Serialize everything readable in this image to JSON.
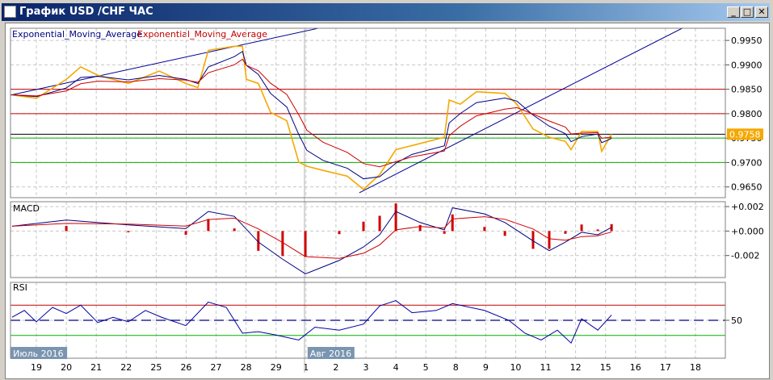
{
  "window": {
    "title": "График USD /CHF  ЧАС",
    "minimize": "_",
    "maximize": "□",
    "close": "✕"
  },
  "legend": {
    "ema1": "Exponential_Moving_Average",
    "ema2": "Exponential_Moving_Average"
  },
  "colors": {
    "price": "#f5a800",
    "ema1": "#000080",
    "ema2": "#d00000",
    "resistance": "#c00000",
    "support": "#00b000",
    "trend": "#000090",
    "macd": "#000080",
    "signal": "#d00000",
    "hist": "#d00000",
    "rsi": "#0000a0"
  },
  "x_axis": {
    "labels": [
      "19",
      "20",
      "21",
      "22",
      "25",
      "26",
      "27",
      "28",
      "29",
      "1",
      "2",
      "3",
      "4",
      "5",
      "8",
      "9",
      "10",
      "11",
      "12",
      "15",
      "16",
      "17",
      "18"
    ],
    "months": [
      {
        "label": "Июль 2016",
        "index": -0.86
      },
      {
        "label": "Авг 2016",
        "index": 9.0
      }
    ]
  },
  "chart_data": [
    {
      "type": "line",
      "title": "USD/CHF H1",
      "yticks": [
        "0.9950",
        "0.9900",
        "0.9850",
        "0.9800",
        "0.9750",
        "0.9700",
        "0.9650"
      ],
      "ylim": [
        0.9628,
        0.9975
      ],
      "current_price": "0.9758",
      "hlines": {
        "resistance": [
          0.985,
          0.98
        ],
        "support": [
          0.975,
          0.97
        ],
        "current": 0.9758
      },
      "trendlines": [
        [
          [
            -0.86,
            0.9838
          ],
          [
            9.44,
            0.99754
          ]
        ],
        [
          [
            10.78,
            0.96381
          ],
          [
            21.57,
            0.99754
          ]
        ]
      ],
      "price": {
        "x": [
          -0.81,
          0,
          1.0,
          1.48,
          2.05,
          3.07,
          4.1,
          4.99,
          5.39,
          5.74,
          6.61,
          6.88,
          7.01,
          7.41,
          7.82,
          8.36,
          8.76,
          9.03,
          9.57,
          10.38,
          10.92,
          11.46,
          12.0,
          12.54,
          13.62,
          13.78,
          14.15,
          14.69,
          15.64,
          16.04,
          16.58,
          17.12,
          17.66,
          17.85,
          18.2,
          18.74,
          18.87,
          19.2
        ],
        "y": [
          0.98386,
          0.98314,
          0.98703,
          0.98958,
          0.98788,
          0.98619,
          0.98873,
          0.98619,
          0.98534,
          0.99297,
          0.99381,
          0.99381,
          0.98703,
          0.98619,
          0.98025,
          0.97856,
          0.97008,
          0.96924,
          0.96839,
          0.9672,
          0.96449,
          0.96754,
          0.97263,
          0.97347,
          0.97517,
          0.9828,
          0.98195,
          0.98449,
          0.98415,
          0.98195,
          0.97686,
          0.97517,
          0.97432,
          0.97263,
          0.97636,
          0.97636,
          0.97229,
          0.9758
        ]
      }
    },
    {
      "type": "line",
      "title": "MACD",
      "yticks": [
        "+0.002",
        "+0.000",
        "-0.002"
      ],
      "ylim": [
        -0.0038,
        0.0024
      ],
      "x": [
        -0.81,
        1.0,
        3.07,
        4.99,
        5.74,
        6.61,
        7.41,
        8.22,
        8.98,
        10.11,
        10.92,
        11.46,
        12.0,
        12.81,
        13.62,
        13.89,
        14.96,
        15.64,
        16.58,
        17.12,
        17.66,
        18.2,
        18.74,
        19.2
      ],
      "macd": [
        0.0004,
        0.0009,
        0.0005,
        0.0002,
        0.0016,
        0.0012,
        -0.0009,
        -0.0023,
        -0.0035,
        -0.0024,
        -0.0013,
        -0.0003,
        0.0016,
        0.0007,
        0.0001,
        0.0019,
        0.0014,
        0.0007,
        -0.0008,
        -0.0016,
        -0.0009,
        -0.0001,
        -0.0003,
        0.0003
      ]
    },
    {
      "type": "line",
      "title": "RSI",
      "yticks": [
        "50"
      ],
      "ylim": [
        0,
        100
      ],
      "levels": [
        70,
        50,
        30
      ],
      "x": [
        -0.81,
        -0.4,
        0,
        0.54,
        1.0,
        1.48,
        2.05,
        2.56,
        3.07,
        3.64,
        4.18,
        4.99,
        5.74,
        6.34,
        6.88,
        7.41,
        7.95,
        8.76,
        9.3,
        10.11,
        10.92,
        11.46,
        12.0,
        12.54,
        13.35,
        13.89,
        14.96,
        15.77,
        16.31,
        16.85,
        17.39,
        17.85,
        18.2,
        18.74,
        19.2
      ],
      "y": [
        54,
        63,
        48,
        67,
        59,
        70,
        47,
        54,
        48,
        63,
        54,
        43,
        74,
        67,
        33,
        35,
        31,
        24,
        41,
        37,
        45,
        69,
        76,
        60,
        63,
        72,
        63,
        50,
        33,
        24,
        37,
        20,
        52,
        37,
        57
      ]
    }
  ]
}
